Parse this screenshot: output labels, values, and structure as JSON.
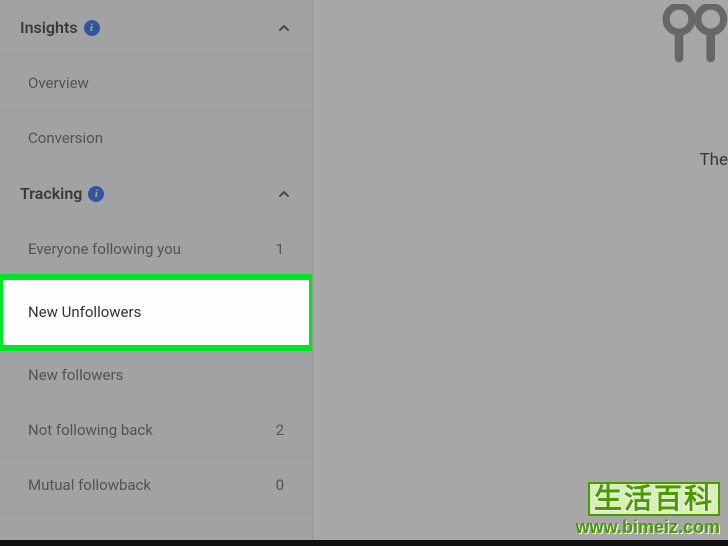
{
  "sidebar": {
    "sections": [
      {
        "title": "Insights",
        "items": [
          {
            "label": "Overview",
            "count": ""
          },
          {
            "label": "Conversion",
            "count": ""
          }
        ]
      },
      {
        "title": "Tracking",
        "items": [
          {
            "label": "Everyone following you",
            "count": "1"
          },
          {
            "label": "New Unfollowers",
            "count": ""
          },
          {
            "label": "New followers",
            "count": ""
          },
          {
            "label": "Not following back",
            "count": "2"
          },
          {
            "label": "Mutual followback",
            "count": "0"
          }
        ]
      }
    ]
  },
  "main": {
    "partial_text": "The"
  },
  "watermark": {
    "text": "生活百科",
    "url": "www.bimeiz.com"
  }
}
